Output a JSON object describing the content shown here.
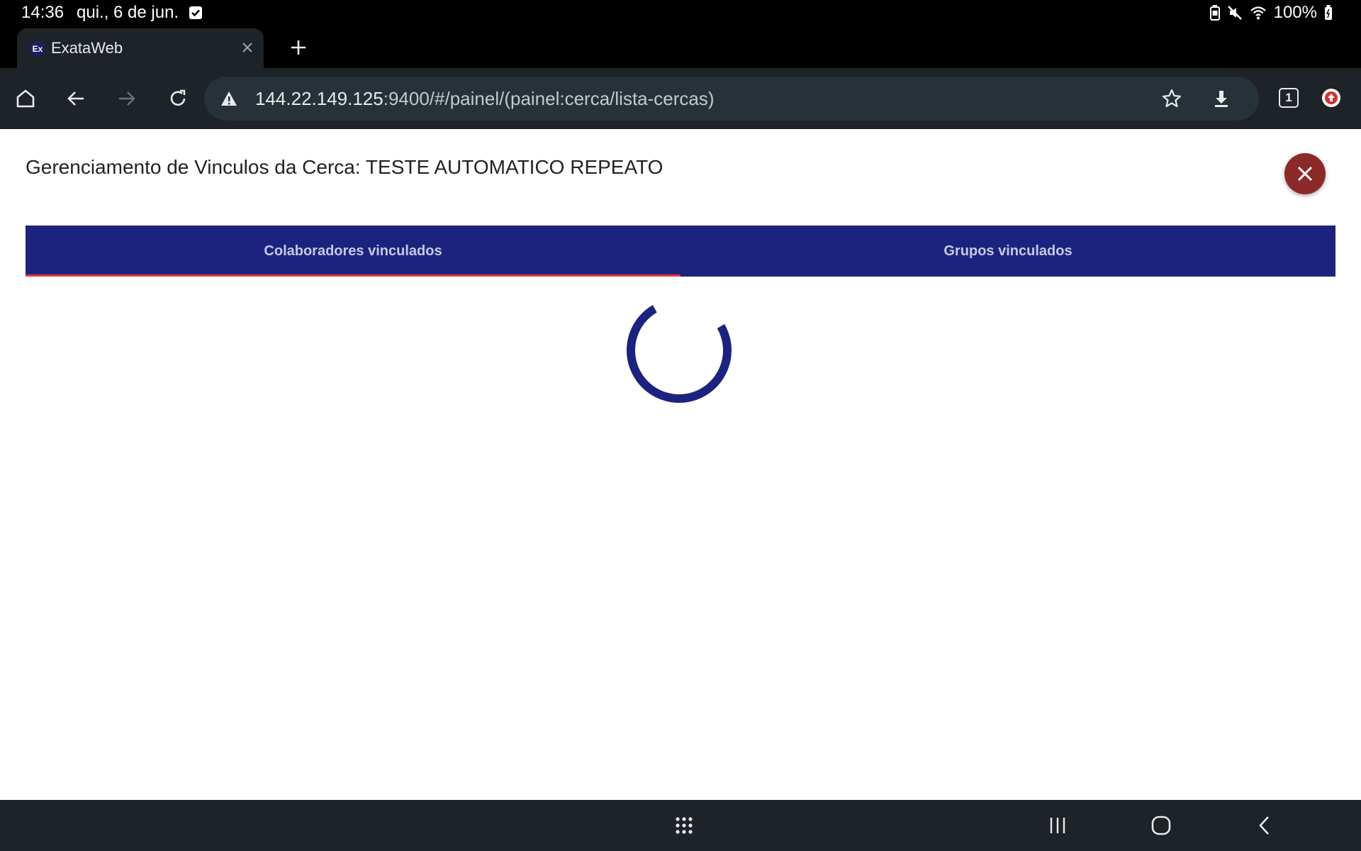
{
  "status_bar": {
    "time": "14:36",
    "date": "qui., 6 de jun.",
    "battery": "100%",
    "icons": [
      "checkbox-notification-icon",
      "battery-saver-icon",
      "mute-icon",
      "wifi-icon",
      "battery-icon"
    ]
  },
  "browser": {
    "tab_title": "ExataWeb",
    "favicon_text": "Ex",
    "url_host": "144.22.149.125",
    "url_rest": ":9400/#/painel/(painel:cerca/lista-cercas)",
    "tab_count": "1"
  },
  "dialog": {
    "title": "Gerenciamento de Vinculos da Cerca: TESTE AUTOMATICO REPEATO",
    "tabs": [
      {
        "label": "Colaboradores vinculados",
        "active": true
      },
      {
        "label": "Grupos vinculados",
        "active": false
      }
    ],
    "loading": true
  },
  "colors": {
    "tab_bar": "#1c237e",
    "active_indicator": "#e53935",
    "close_button": "#8c2a2a",
    "spinner": "#1c237e"
  }
}
